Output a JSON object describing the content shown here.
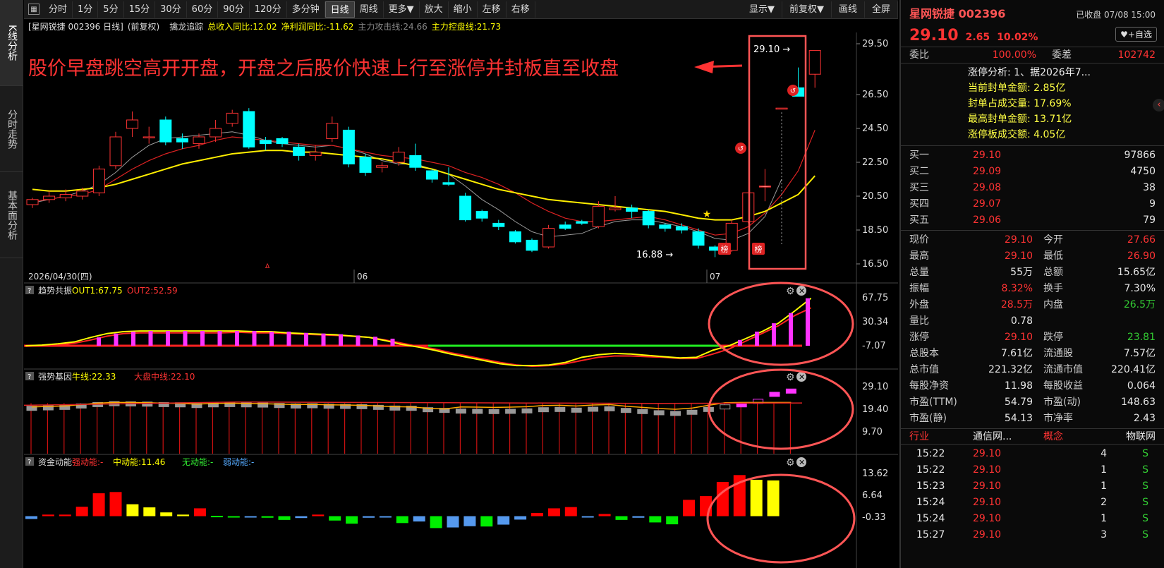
{
  "nav": {
    "tabs": [
      "K线分析",
      "分时走势",
      "基本面分析"
    ]
  },
  "toolbar": {
    "items": [
      "分时",
      "1分",
      "5分",
      "15分",
      "30分",
      "60分",
      "90分",
      "120分",
      "多分钟",
      "日线",
      "周线",
      "更多▼",
      "放大",
      "缩小",
      "左移",
      "右移"
    ],
    "active": "日线",
    "right_items": [
      "显示▼",
      "前复权▼",
      "画线",
      "全屏"
    ]
  },
  "title": {
    "name": "[星网锐捷 002396 日线]",
    "adjust": "(前复权)",
    "indicator": "擒龙追踪",
    "revenue": "总收入同比:12.02",
    "profit": "净利润同比:-11.62",
    "attack": "主力攻击线:24.66",
    "control": "主力控盘线:21.73"
  },
  "main_chart": {
    "annotation": "股价早盘跳空高开开盘，开盘之后股价快速上行至涨停并封板直至收盘",
    "y_labels": [
      "29.50",
      "26.50",
      "24.50",
      "22.50",
      "20.50",
      "18.50",
      "16.50"
    ],
    "x_labels": [
      "2026/04/30(四)",
      "06",
      "07"
    ],
    "high_label": "29.10",
    "low_label": "16.88",
    "bang": "榜"
  },
  "chart_data": {
    "type": "candlestick",
    "candles": [
      [
        20.0,
        20.3,
        19.8,
        20.4
      ],
      [
        20.3,
        20.5,
        20.1,
        20.8
      ],
      [
        20.4,
        20.6,
        20.2,
        20.9
      ],
      [
        20.5,
        20.8,
        20.3,
        21.0
      ],
      [
        20.7,
        22.1,
        20.5,
        22.3
      ],
      [
        22.3,
        24.0,
        22.1,
        24.3
      ],
      [
        24.5,
        25.0,
        24.0,
        25.5
      ],
      [
        24.0,
        24.0,
        23.6,
        24.6
      ],
      [
        25.0,
        23.7,
        23.5,
        25.2
      ],
      [
        23.9,
        23.7,
        23.3,
        24.2
      ],
      [
        23.6,
        24.0,
        23.3,
        24.2
      ],
      [
        24.0,
        24.5,
        23.7,
        25.0
      ],
      [
        24.8,
        25.4,
        24.6,
        25.6
      ],
      [
        25.5,
        23.4,
        23.3,
        25.7
      ],
      [
        23.8,
        23.6,
        23.2,
        24.0
      ],
      [
        23.9,
        23.6,
        23.4,
        24.0
      ],
      [
        23.4,
        22.9,
        22.6,
        23.6
      ],
      [
        22.9,
        23.1,
        22.6,
        23.5
      ],
      [
        23.9,
        24.8,
        23.7,
        25.2
      ],
      [
        24.4,
        22.4,
        22.2,
        24.6
      ],
      [
        22.8,
        21.9,
        21.7,
        23.0
      ],
      [
        22.2,
        22.3,
        21.9,
        22.5
      ],
      [
        22.5,
        23.1,
        22.3,
        23.4
      ],
      [
        22.9,
        22.2,
        22.0,
        23.6
      ],
      [
        22.0,
        21.5,
        21.3,
        22.1
      ],
      [
        21.3,
        21.2,
        21.1,
        22.2
      ],
      [
        20.5,
        19.1,
        19.0,
        20.7
      ],
      [
        19.6,
        19.2,
        19.0,
        19.7
      ],
      [
        18.9,
        18.7,
        18.5,
        19.1
      ],
      [
        18.4,
        17.8,
        17.7,
        18.5
      ],
      [
        17.9,
        17.3,
        17.2,
        18.0
      ],
      [
        17.5,
        18.6,
        17.4,
        18.8
      ],
      [
        18.8,
        18.6,
        18.5,
        19.0
      ],
      [
        19.0,
        18.9,
        18.8,
        19.1
      ],
      [
        18.7,
        19.9,
        18.6,
        20.2
      ],
      [
        19.7,
        19.8,
        19.6,
        20.5
      ],
      [
        19.8,
        19.6,
        19.2,
        20.0
      ],
      [
        19.6,
        18.8,
        18.6,
        19.7
      ],
      [
        18.8,
        18.6,
        18.4,
        18.9
      ],
      [
        18.7,
        18.5,
        18.3,
        18.9
      ],
      [
        18.4,
        17.6,
        17.4,
        18.6
      ],
      [
        17.5,
        17.3,
        16.9,
        17.6
      ],
      [
        17.3,
        18.9,
        17.2,
        19.1
      ],
      [
        19.0,
        20.7,
        18.9,
        20.7
      ],
      [
        21.1,
        21.1,
        20.2,
        22.1
      ],
      [
        25.7,
        25.7,
        25.7,
        25.7
      ],
      [
        26.9,
        26.4,
        26.4,
        28.1
      ],
      [
        27.7,
        29.1,
        26.9,
        29.1
      ]
    ],
    "limit_up_flags": [
      43,
      45,
      47
    ],
    "ma_red": [
      20.2,
      20.3,
      20.5,
      20.6,
      20.9,
      21.5,
      22.1,
      22.6,
      23.0,
      23.3,
      23.5,
      23.8,
      24.0,
      23.9,
      23.8,
      23.7,
      23.6,
      23.5,
      23.5,
      23.3,
      23.1,
      22.9,
      22.8,
      22.7,
      22.5,
      22.3,
      21.9,
      21.6,
      21.2,
      20.7,
      20.1,
      19.6,
      19.2,
      19.0,
      19.0,
      19.1,
      19.2,
      19.3,
      19.1,
      18.8,
      18.5,
      18.2,
      18.3,
      18.7,
      19.5,
      20.6,
      22.0,
      24.4
    ],
    "ma_yellow": [
      20.9,
      20.8,
      20.8,
      20.9,
      21.0,
      21.2,
      21.5,
      21.8,
      22.1,
      22.4,
      22.6,
      22.8,
      23.0,
      23.1,
      23.2,
      23.2,
      23.1,
      23.1,
      23.0,
      22.9,
      22.8,
      22.7,
      22.5,
      22.3,
      22.1,
      21.8,
      21.5,
      21.2,
      20.9,
      20.7,
      20.5,
      20.3,
      20.2,
      20.1,
      20.0,
      19.9,
      19.8,
      19.7,
      19.6,
      19.4,
      19.2,
      19.1,
      19.1,
      19.3,
      19.6,
      20.1,
      20.6,
      21.7
    ],
    "ma_gray": [
      20.1,
      20.3,
      20.5,
      20.8,
      21.2,
      21.9,
      22.8,
      23.5,
      23.9,
      24.0,
      24.1,
      24.2,
      24.3,
      24.1,
      23.8,
      23.6,
      23.5,
      23.4,
      23.5,
      23.3,
      23.0,
      22.6,
      22.4,
      22.4,
      22.1,
      21.8,
      21.1,
      20.3,
      19.7,
      19.0,
      18.4,
      18.1,
      18.2,
      18.3,
      18.7,
      19.0,
      19.1,
      19.1,
      18.9,
      18.7,
      18.4,
      18.0,
      17.9,
      18.3,
      19.3,
      21.5
    ],
    "ylim": [
      16.0,
      30.0
    ]
  },
  "panel2": {
    "icon": "?",
    "name": "趋势共振",
    "out1": "OUT1:67.75",
    "out2": "OUT2:52.59",
    "y_labels": [
      "67.75",
      "30.34",
      "-7.07"
    ]
  },
  "panel3": {
    "icon": "?",
    "name": "强势基因",
    "bull": "牛线:22.33",
    "market": "大盘中线:22.10",
    "y_labels": [
      "29.10",
      "19.40",
      "9.70"
    ]
  },
  "panel4": {
    "icon": "?",
    "name": "资金动能",
    "strong": "强动能:-",
    "mid": "中动能:11.46",
    "none": "无动能:-",
    "weak": "弱动能:-",
    "y_labels": [
      "13.62",
      "6.64",
      "-0.33"
    ],
    "bars": [
      -0.9,
      0.5,
      0.5,
      3.0,
      7.3,
      7.7,
      3.8,
      2.8,
      1.2,
      0.5,
      2.5,
      0.1,
      -0.4,
      -0.2,
      -0.5,
      -1.2,
      -0.6,
      0.5,
      -1.4,
      -2.4,
      -0.5,
      -0.3,
      -2.2,
      -1.7,
      -3.8,
      -3.6,
      -3.2,
      -3.3,
      -2.7,
      -1.1,
      1.0,
      2.5,
      2.9,
      -0.3,
      0.7,
      -1.2,
      -0.5,
      -2.0,
      -2.6,
      5.2,
      6.4,
      10.9,
      13.1,
      11.6,
      11.4
    ],
    "colors": [
      "#5599ee",
      "#ff0000",
      "#ff0000",
      "#ff0000",
      "#ff0000",
      "#ff0000",
      "#ffff00",
      "#ffff00",
      "#ffff00",
      "#ffff00",
      "#ff0000",
      "#00ee00",
      "#00ee00",
      "#5599ee",
      "#00ee00",
      "#00ee00",
      "#5599ee",
      "#ff0000",
      "#00ee00",
      "#00ee00",
      "#5599ee",
      "#5599ee",
      "#00ee00",
      "#5599ee",
      "#00ee00",
      "#5599ee",
      "#5599ee",
      "#00ee00",
      "#5599ee",
      "#5599ee",
      "#ff0000",
      "#ff0000",
      "#ff0000",
      "#5599ee",
      "#ff0000",
      "#00ee00",
      "#5599ee",
      "#00ee00",
      "#00ee00",
      "#ff0000",
      "#ff0000",
      "#ff0000",
      "#ff0000",
      "#ffff00",
      "#ffff00"
    ]
  },
  "right": {
    "name": "星网锐捷 002396",
    "status": "已收盘 07/08 15:00",
    "price": "29.10",
    "change": "2.65",
    "pct": "10.02%",
    "watch": "♥+自选",
    "webi_k": "委比",
    "webi_v": "100.00%",
    "weicha_k": "委差",
    "weicha_v": "102742",
    "zt": [
      "涨停分析:  1、据2026年7...",
      "当前封单金额: 2.85亿",
      "封单占成交量: 17.69%",
      "最高封单金额: 13.71亿",
      "涨停板成交额: 4.05亿"
    ],
    "bids": [
      {
        "k": "买一",
        "p": "29.10",
        "v": "97866"
      },
      {
        "k": "买二",
        "p": "29.09",
        "v": "4750"
      },
      {
        "k": "买三",
        "p": "29.08",
        "v": "38"
      },
      {
        "k": "买四",
        "p": "29.07",
        "v": "9"
      },
      {
        "k": "买五",
        "p": "29.06",
        "v": "79"
      }
    ],
    "stats": [
      {
        "k1": "现价",
        "v1": "29.10",
        "c1": "red",
        "k2": "今开",
        "v2": "27.66",
        "c2": "red"
      },
      {
        "k1": "最高",
        "v1": "29.10",
        "c1": "red",
        "k2": "最低",
        "v2": "26.90",
        "c2": "red"
      },
      {
        "k1": "总量",
        "v1": "55万",
        "c1": "white",
        "k2": "总额",
        "v2": "15.65亿",
        "c2": "white"
      },
      {
        "k1": "振幅",
        "v1": "8.32%",
        "c1": "red",
        "k2": "换手",
        "v2": "7.30%",
        "c2": "white"
      },
      {
        "k1": "外盘",
        "v1": "28.5万",
        "c1": "red",
        "k2": "内盘",
        "v2": "26.5万",
        "c2": "green"
      },
      {
        "k1": "量比",
        "v1": "0.78",
        "c1": "white",
        "k2": "",
        "v2": "",
        "c2": "white"
      },
      {
        "k1": "涨停",
        "v1": "29.10",
        "c1": "red",
        "k2": "跌停",
        "v2": "23.81",
        "c2": "green"
      },
      {
        "k1": "总股本",
        "v1": "7.61亿",
        "c1": "white",
        "k2": "流通股",
        "v2": "7.57亿",
        "c2": "white"
      },
      {
        "k1": "总市值",
        "v1": "221.32亿",
        "c1": "white",
        "k2": "流通市值",
        "v2": "220.41亿",
        "c2": "white"
      },
      {
        "k1": "每股净资",
        "v1": "11.98",
        "c1": "white",
        "k2": "每股收益",
        "v2": "0.064",
        "c2": "white"
      },
      {
        "k1": "市盈(TTM)",
        "v1": "54.79",
        "c1": "white",
        "k2": "市盈(动)",
        "v2": "148.63",
        "c2": "white"
      },
      {
        "k1": "市盈(静)",
        "v1": "54.13",
        "c1": "white",
        "k2": "市净率",
        "v2": "2.43",
        "c2": "white"
      }
    ],
    "industry": {
      "k1": "行业",
      "v1": "通信网...",
      "k2": "概念",
      "v2": "物联网"
    },
    "ticks": [
      {
        "t": "15:22",
        "p": "29.10",
        "v": "4",
        "s": "S"
      },
      {
        "t": "15:22",
        "p": "29.10",
        "v": "1",
        "s": "S"
      },
      {
        "t": "15:23",
        "p": "29.10",
        "v": "1",
        "s": "S"
      },
      {
        "t": "15:24",
        "p": "29.10",
        "v": "2",
        "s": "S"
      },
      {
        "t": "15:24",
        "p": "29.10",
        "v": "1",
        "s": "S"
      },
      {
        "t": "15:27",
        "p": "29.10",
        "v": "3",
        "s": "S"
      }
    ]
  }
}
